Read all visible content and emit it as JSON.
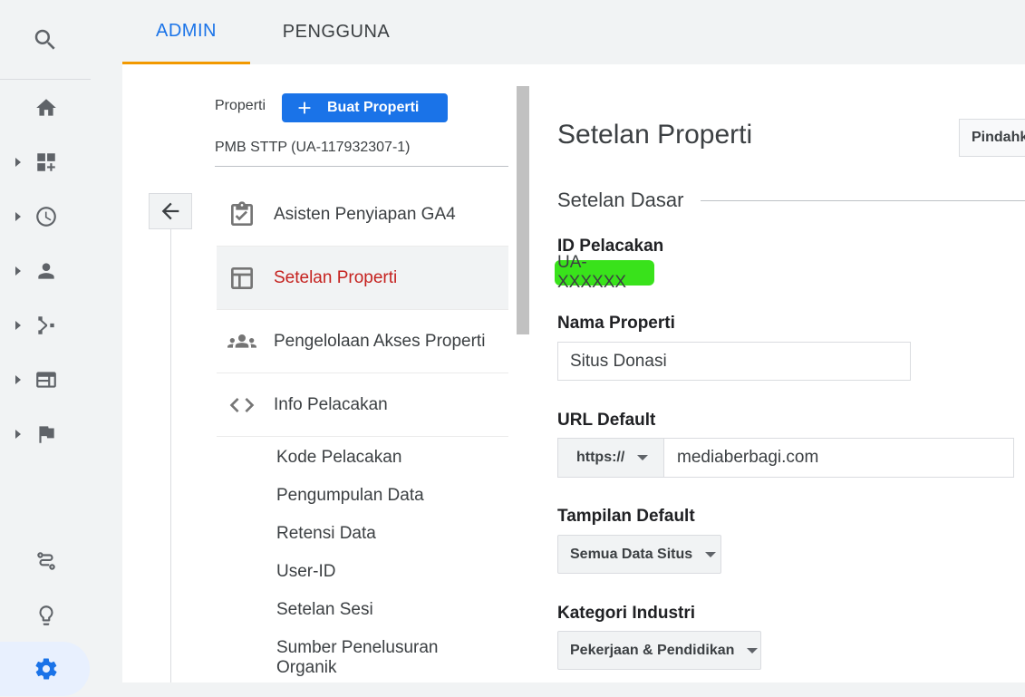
{
  "tabs": [
    {
      "label": "ADMIN",
      "active": true
    },
    {
      "label": "PENGGUNA",
      "active": false
    }
  ],
  "rail": {
    "icons": [
      "search-icon",
      "home-icon",
      "dashboard-add-icon",
      "clock-icon",
      "person-icon",
      "flow-icon",
      "web-layout-icon",
      "flag-icon",
      "route-icon",
      "lightbulb-icon",
      "gear-icon"
    ]
  },
  "property": {
    "label": "Properti",
    "create_button": "Buat Properti",
    "selected": "PMB STTP (UA-117932307-1)"
  },
  "menu": [
    {
      "label": "Asisten Penyiapan GA4",
      "icon": "clipboard-check-icon",
      "active": false
    },
    {
      "label": "Setelan Properti",
      "icon": "layout-icon",
      "active": true
    },
    {
      "label": "Pengelolaan Akses Properti",
      "icon": "group-icon",
      "active": false
    },
    {
      "label": "Info Pelacakan",
      "icon": "code-icon",
      "active": false
    }
  ],
  "submenu": [
    "Kode Pelacakan",
    "Pengumpulan Data",
    "Retensi Data",
    "User-ID",
    "Setelan Sesi",
    "Sumber Penelusuran Organik"
  ],
  "content": {
    "title": "Setelan Properti",
    "move_button": "Pindahk",
    "section": "Setelan Dasar",
    "tracking_id_label": "ID Pelacakan",
    "tracking_id": "UA-XXXXXX",
    "property_name_label": "Nama Properti",
    "property_name": "Situs Donasi",
    "default_url_label": "URL Default",
    "url_protocol": "https://",
    "url_host": "mediaberbagi.com",
    "default_view_label": "Tampilan Default",
    "default_view": "Semua Data Situs",
    "industry_label": "Kategori Industri",
    "industry": "Pekerjaan & Pendidikan"
  },
  "colors": {
    "accent": "#1a73e8",
    "tab_underline": "#f29900",
    "active_menu_text": "#c5221f",
    "highlight": "#39e21b"
  }
}
